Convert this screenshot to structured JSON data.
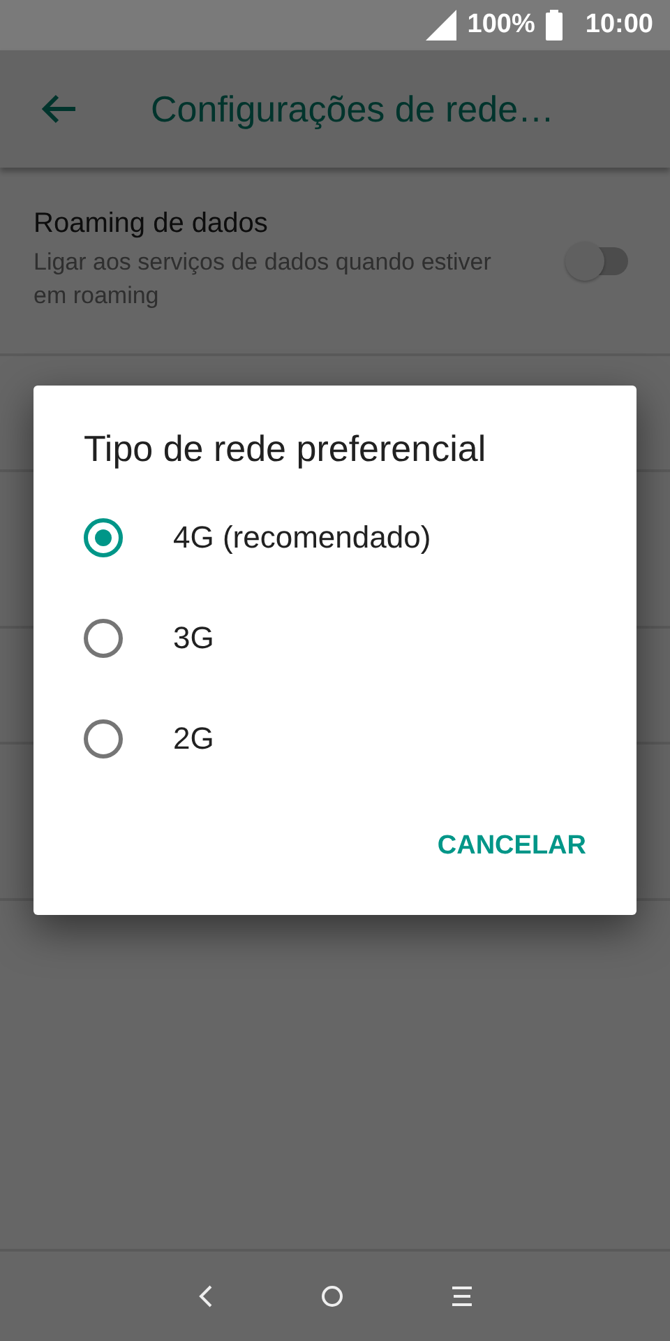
{
  "status_bar": {
    "battery": "100%",
    "time": "10:00"
  },
  "toolbar": {
    "title": "Configurações de rede…"
  },
  "settings": [
    {
      "title": "Roaming de dados",
      "summary": "Ligar aos serviços de dados quando estiver em roaming",
      "on": false
    }
  ],
  "dialog": {
    "title": "Tipo de rede preferencial",
    "options": [
      {
        "label": "4G (recomendado)",
        "selected": true
      },
      {
        "label": "3G",
        "selected": false
      },
      {
        "label": "2G",
        "selected": false
      }
    ],
    "buttons": [
      "CANCELAR"
    ]
  }
}
